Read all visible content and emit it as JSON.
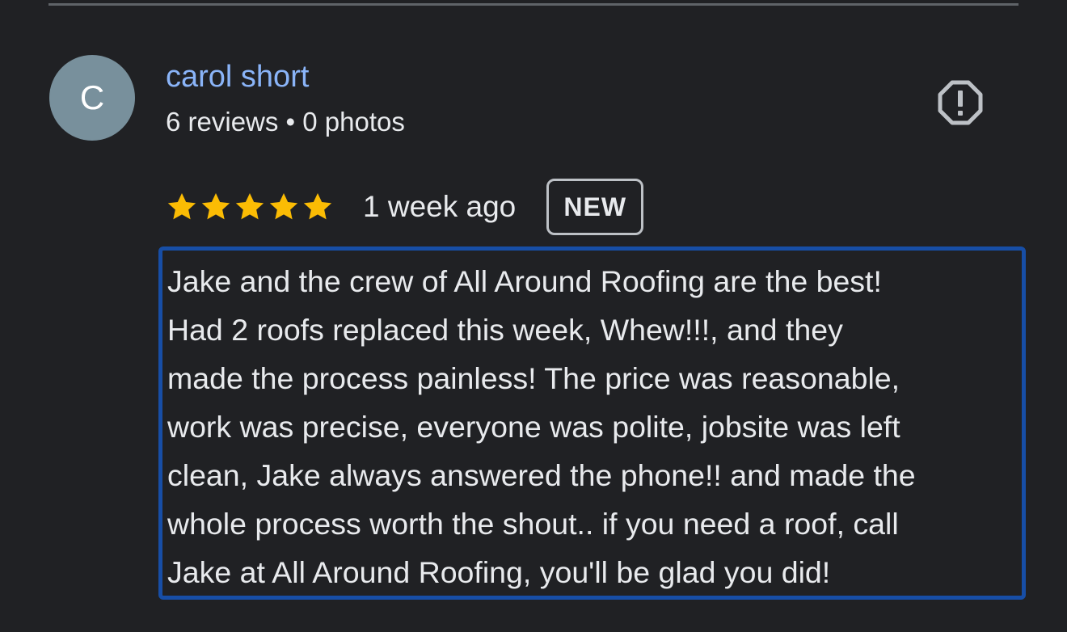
{
  "reviewer": {
    "avatar_initial": "C",
    "name": "carol short",
    "meta": "6 reviews • 0 photos"
  },
  "rating": {
    "stars": 5,
    "max_stars": 5,
    "star_color": "#fbbc04",
    "time_ago": "1 week ago",
    "badge": "NEW"
  },
  "review": {
    "text": "Jake and the crew of All Around Roofing are the best!\nHad 2 roofs replaced this week, Whew!!!, and they\nmade the process painless! The price was reasonable,\nwork was precise, everyone was polite, jobsite was left\nclean, Jake always answered the phone!! and made the\nwhole process worth the shout.. if you need a roof, call\nJake at All Around Roofing, you'll be glad you did!"
  },
  "icons": {
    "report": "report-flag-icon",
    "star": "star-icon"
  },
  "colors": {
    "background": "#202124",
    "name_link": "#8ab4f8",
    "highlight_border": "#174ea6"
  }
}
